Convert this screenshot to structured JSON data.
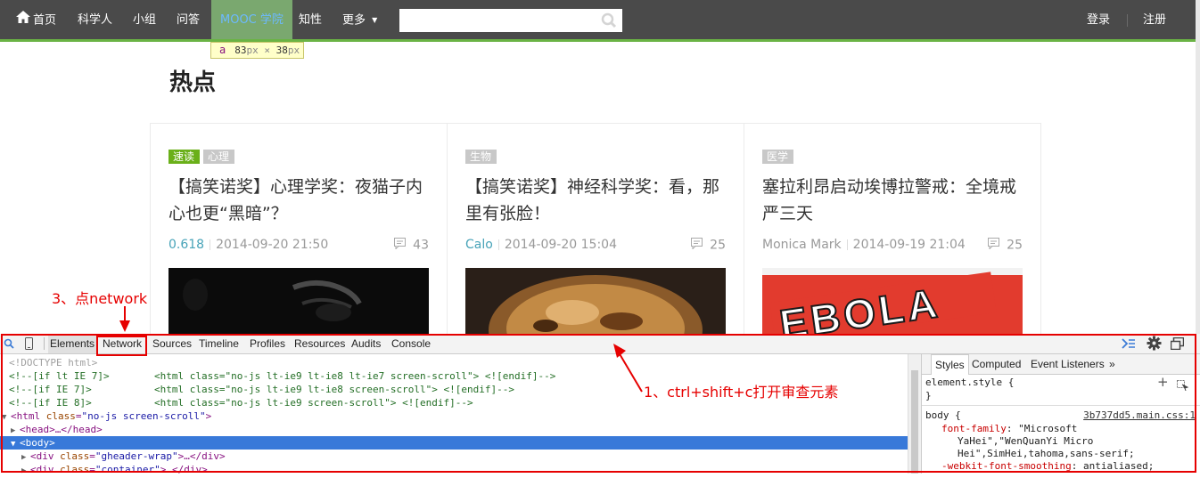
{
  "nav": {
    "items": [
      {
        "label": "首页",
        "name": "nav-home"
      },
      {
        "label": "科学人",
        "name": "nav-scientist"
      },
      {
        "label": "小组",
        "name": "nav-group"
      },
      {
        "label": "问答",
        "name": "nav-qa"
      },
      {
        "label": "MOOC 学院",
        "name": "nav-mooc"
      },
      {
        "label": "知性",
        "name": "nav-zhixing"
      },
      {
        "label": "更多",
        "name": "nav-more"
      }
    ],
    "search_placeholder": "",
    "login": "登录",
    "register": "注册"
  },
  "tooltip": {
    "tag": "a",
    "width": "83",
    "height": "38",
    "unit": "px",
    "times": "×"
  },
  "page": {
    "title": "热点"
  },
  "cards": [
    {
      "tags": [
        "速读",
        "心理"
      ],
      "title": "【搞笑诺奖】心理学奖：夜猫子内心也更“黑暗”？",
      "author": "0.618",
      "date": "2014-09-20 21:50",
      "comments": "43"
    },
    {
      "tags": [
        "生物"
      ],
      "title": "【搞笑诺奖】神经科学奖：看，那里有张脸！",
      "author": "Calo",
      "date": "2014-09-20 15:04",
      "comments": "25"
    },
    {
      "tags": [
        "医学"
      ],
      "title": "塞拉利昂启动埃博拉警戒：全境戒严三天",
      "author": "Monica Mark",
      "date": "2014-09-19 21:04",
      "comments": "25"
    }
  ],
  "image_text": {
    "ebola": "EBOLA"
  },
  "annotations": {
    "step3": "3、点network",
    "step1": "1、ctrl+shift+c打开审查元素"
  },
  "devtools": {
    "tabs": [
      "Elements",
      "Network",
      "Sources",
      "Timeline",
      "Profiles",
      "Resources",
      "Audits",
      "Console"
    ],
    "code": {
      "doctype": "<!DOCTYPE html>",
      "l1_cond": "<!--[if lt IE 7]>",
      "l1_html": "<html class=\"no-js lt-ie9 lt-ie8 lt-ie7 screen-scroll\"> <![endif]-->",
      "l2_cond": "<!--[if IE 7]>",
      "l2_html": "<html class=\"no-js lt-ie9 lt-ie8 screen-scroll\"> <![endif]-->",
      "l3_cond": "<!--[if IE 8]>",
      "l3_html": "<html class=\"no-js lt-ie9 screen-scroll\"> <![endif]-->",
      "html_tag": "<html",
      "html_attr": "class",
      "html_val": "\"no-js screen-scroll\"",
      "html_close": ">",
      "head": "<head>…</head>",
      "body": "<body>",
      "div1_open": "<div",
      "div1_attr": "class",
      "div1_val": "\"gheader-wrap\"",
      "div1_close": ">…</div>",
      "div2_open": "<div",
      "div2_attr": "class",
      "div2_val": "\"container\"",
      "div2_close": ">…</div>"
    },
    "side_tabs": [
      "Styles",
      "Computed",
      "Event Listeners",
      "»"
    ],
    "styles": {
      "element_style": "element.style {",
      "close_brace": "}",
      "body_sel": "body {",
      "source": "3b737dd5.main.css:1",
      "font_family_prop": "font-family",
      "font_family_val_1": "\"Microsoft",
      "font_family_val_2": "YaHei\",\"WenQuanYi Micro",
      "font_family_val_3": "Hei\",SimHei,tahoma,sans-serif;",
      "smoothing_prop": "-webkit-font-smoothing",
      "smoothing_val": "antialiased;"
    }
  },
  "colors": {
    "nav_bg": "#4a4a4a",
    "accent_green": "#6ab344",
    "annotation_red": "#e60000",
    "selection_blue": "#3879d9"
  }
}
